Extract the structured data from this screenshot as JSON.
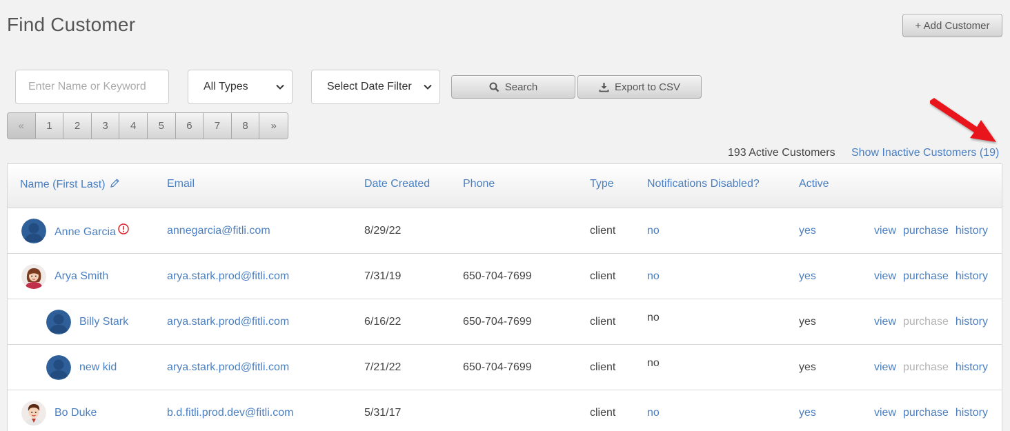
{
  "header": {
    "title": "Find Customer",
    "add_button": "+ Add Customer"
  },
  "filters": {
    "search_placeholder": "Enter Name or Keyword",
    "type_select": "All Types",
    "date_select": "Select Date Filter",
    "search_button": "Search",
    "export_button": "Export to CSV"
  },
  "pagination": {
    "prev": "«",
    "pages": [
      "1",
      "2",
      "3",
      "4",
      "5",
      "6",
      "7",
      "8"
    ],
    "next": "»"
  },
  "summary": {
    "active_count": "193 Active Customers",
    "show_inactive": "Show Inactive Customers (19)"
  },
  "table": {
    "headers": {
      "name": "Name (First Last)",
      "email": "Email",
      "date": "Date Created",
      "phone": "Phone",
      "type": "Type",
      "notifications": "Notifications Disabled?",
      "active": "Active"
    },
    "rows": [
      {
        "name": "Anne Garcia",
        "email": "annegarcia@fitli.com",
        "date": "8/29/22",
        "phone": "",
        "type": "client",
        "notifications": "no",
        "active": "yes",
        "view": "view",
        "purchase": "purchase",
        "history": "history",
        "avatar": "default-avatar-icon",
        "warning": true,
        "child": false
      },
      {
        "name": "Arya Smith",
        "email": "arya.stark.prod@fitli.com",
        "date": "7/31/19",
        "phone": "650-704-7699",
        "type": "client",
        "notifications": "no",
        "active": "yes",
        "view": "view",
        "purchase": "purchase",
        "history": "history",
        "avatar": "female-avatar-icon",
        "warning": false,
        "child": false
      },
      {
        "name": "Billy Stark",
        "email": "arya.stark.prod@fitli.com",
        "date": "6/16/22",
        "phone": "650-704-7699",
        "type": "client",
        "notifications": "no",
        "active": "yes",
        "view": "view",
        "purchase": "purchase",
        "history": "history",
        "avatar": "default-avatar-icon",
        "warning": false,
        "child": true
      },
      {
        "name": "new kid",
        "email": "arya.stark.prod@fitli.com",
        "date": "7/21/22",
        "phone": "650-704-7699",
        "type": "client",
        "notifications": "no",
        "active": "yes",
        "view": "view",
        "purchase": "purchase",
        "history": "history",
        "avatar": "default-avatar-icon",
        "warning": false,
        "child": true
      },
      {
        "name": "Bo Duke",
        "email": "b.d.fitli.prod.dev@fitli.com",
        "date": "5/31/17",
        "phone": "",
        "type": "client",
        "notifications": "no",
        "active": "yes",
        "view": "view",
        "purchase": "purchase",
        "history": "history",
        "avatar": "male-avatar-icon",
        "warning": false,
        "child": false
      }
    ]
  },
  "colors": {
    "link": "#4a7fc1",
    "muted": "#b3b3b3",
    "warning": "#d9232d",
    "arrow": "#e8151b"
  }
}
